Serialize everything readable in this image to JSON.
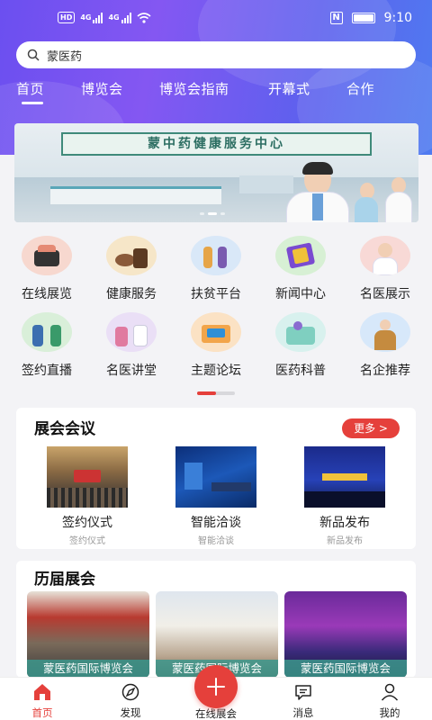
{
  "status_bar": {
    "network_left": "HD",
    "net_a": "4G",
    "net_b": "4G",
    "nfc": "N",
    "time": "9:10"
  },
  "search": {
    "value": "蒙医药"
  },
  "tabs": [
    {
      "label": "首页",
      "active": true
    },
    {
      "label": "博览会"
    },
    {
      "label": "博览会指南"
    },
    {
      "label": "开幕式"
    },
    {
      "label": "合作"
    }
  ],
  "banner": {
    "title": "蒙中药健康服务中心"
  },
  "grid": [
    {
      "label": "在线展览",
      "icon": "exhibition-icon"
    },
    {
      "label": "健康服务",
      "icon": "health-service-icon"
    },
    {
      "label": "扶贫平台",
      "icon": "poverty-relief-icon"
    },
    {
      "label": "新闻中心",
      "icon": "news-icon"
    },
    {
      "label": "名医展示",
      "icon": "doctor-icon"
    },
    {
      "label": "签约直播",
      "icon": "contract-live-icon"
    },
    {
      "label": "名医讲堂",
      "icon": "lecture-icon"
    },
    {
      "label": "主题论坛",
      "icon": "forum-icon"
    },
    {
      "label": "医药科普",
      "icon": "science-icon"
    },
    {
      "label": "名企推荐",
      "icon": "enterprise-icon"
    }
  ],
  "meetings": {
    "title": "展会会议",
    "more": "更多 >",
    "items": [
      {
        "title": "签约仪式",
        "sub": "签约仪式"
      },
      {
        "title": "智能洽谈",
        "sub": "智能洽谈"
      },
      {
        "title": "新品发布",
        "sub": "新品发布"
      }
    ]
  },
  "past": {
    "title": "历届展会",
    "items": [
      {
        "caption": "蒙医药国际博览会"
      },
      {
        "caption": "蒙医药国际博览会"
      },
      {
        "caption": "蒙医药国际博览会"
      }
    ]
  },
  "bottom_nav": [
    {
      "label": "首页",
      "active": true
    },
    {
      "label": "发现"
    },
    {
      "label": "在线展会"
    },
    {
      "label": "消息"
    },
    {
      "label": "我的"
    }
  ],
  "colors": {
    "accent": "#e5403b",
    "hero_start": "#6b4ff0",
    "hero_end": "#4f7bf0"
  }
}
